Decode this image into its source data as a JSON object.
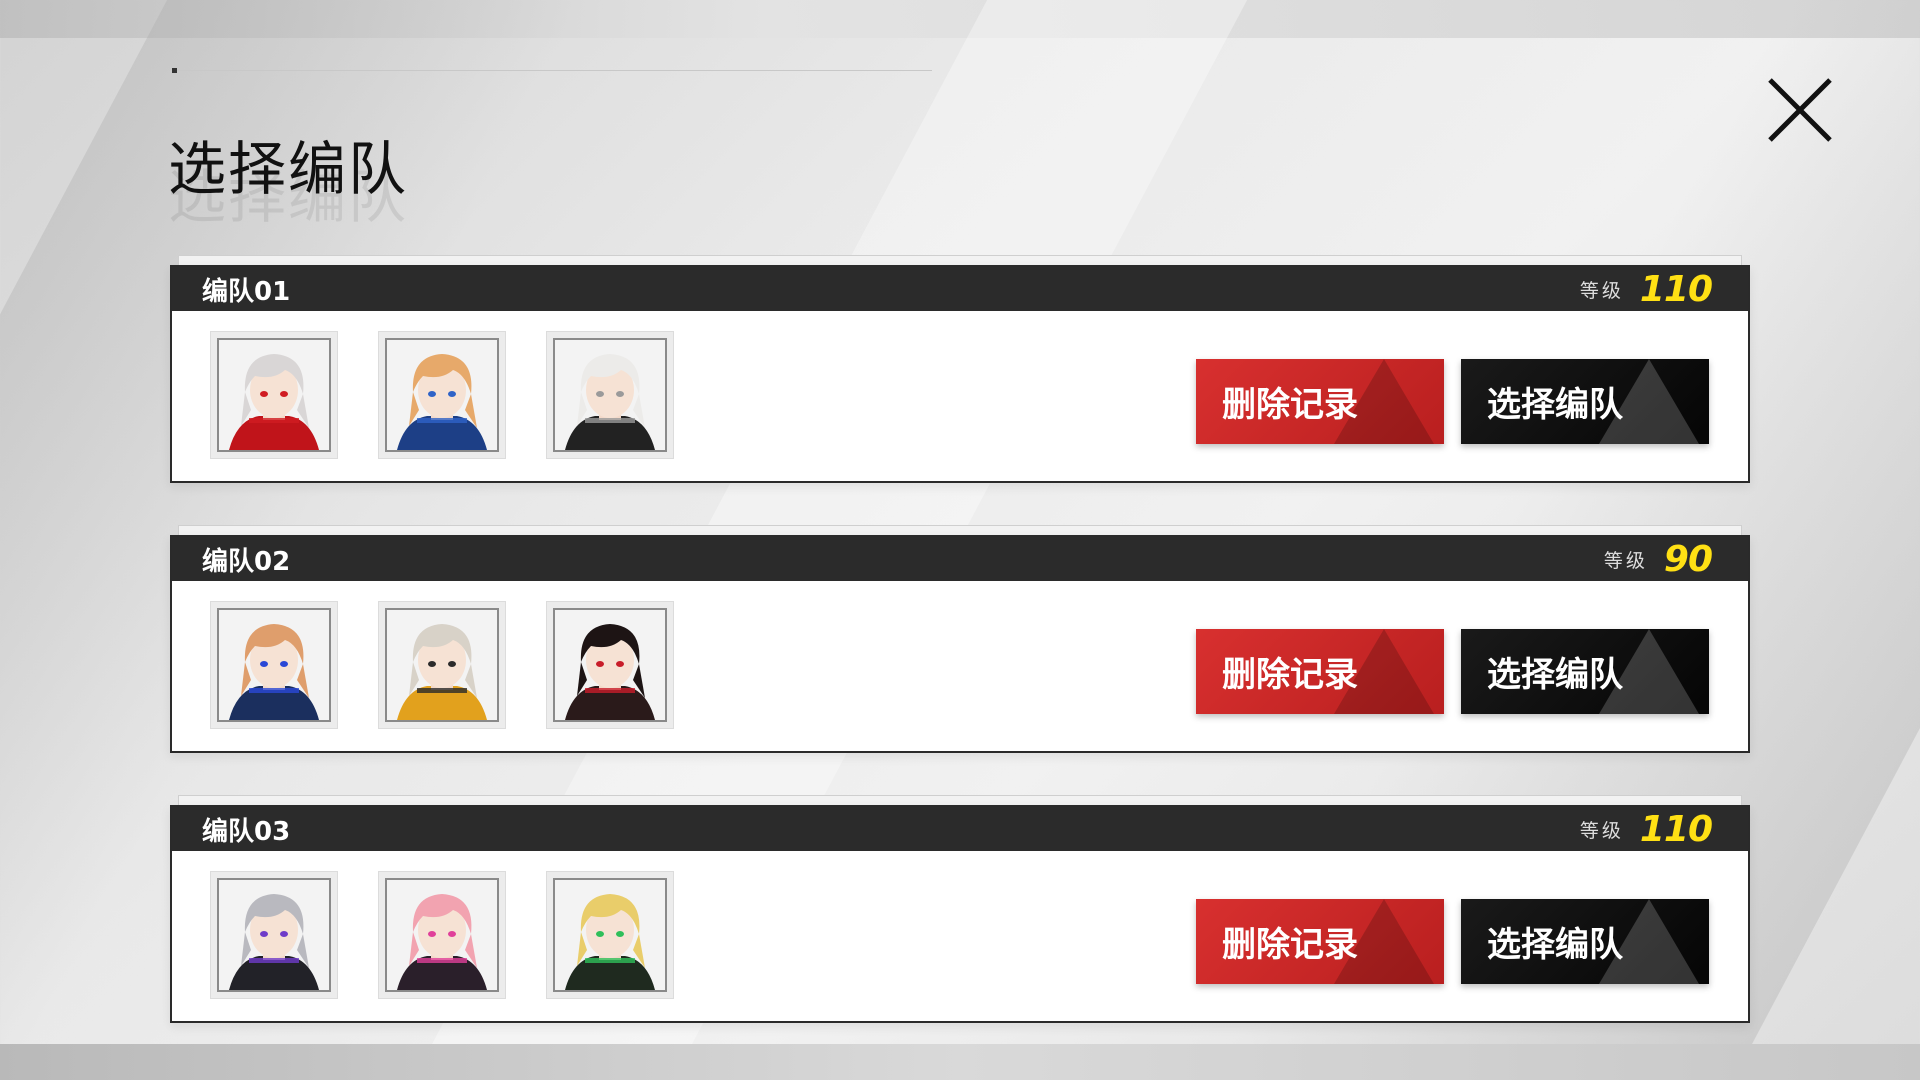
{
  "page": {
    "title": "选择编队"
  },
  "teams": [
    {
      "name": "编队01",
      "level_label": "等级",
      "level": "110",
      "delete_label": "删除记录",
      "select_label": "选择编队",
      "avatars": [
        {
          "icon": "character-silver-hair-red-headphones",
          "hair": "#d9d6d6",
          "outfit": "#c0141a",
          "accent": "#d01c22"
        },
        {
          "icon": "character-orange-hair-blue-collar",
          "hair": "#e7a96a",
          "outfit": "#1d3f86",
          "accent": "#2f63c7"
        },
        {
          "icon": "character-white-hair-black-outfit",
          "hair": "#ecebe9",
          "outfit": "#222222",
          "accent": "#9a9a9a"
        }
      ]
    },
    {
      "name": "编队02",
      "level_label": "等级",
      "level": "90",
      "delete_label": "删除记录",
      "select_label": "选择编队",
      "avatars": [
        {
          "icon": "character-orange-hair-blue-horn",
          "hair": "#df9e6c",
          "outfit": "#1b2f5e",
          "accent": "#2a48d6"
        },
        {
          "icon": "character-silver-hair-yellow-outfit",
          "hair": "#d8d2c8",
          "outfit": "#e2a11d",
          "accent": "#2b2b2b"
        },
        {
          "icon": "character-black-hair-red-eyes",
          "hair": "#1d1414",
          "outfit": "#2a1a1a",
          "accent": "#c81d2a"
        }
      ]
    },
    {
      "name": "编队03",
      "level_label": "等级",
      "level": "110",
      "delete_label": "删除记录",
      "select_label": "选择编队",
      "avatars": [
        {
          "icon": "character-grey-hair-purple-headset",
          "hair": "#b9b9bf",
          "outfit": "#222228",
          "accent": "#6f3cc9"
        },
        {
          "icon": "character-pink-hair-black-cap",
          "hair": "#f2a3b0",
          "outfit": "#2a1f2a",
          "accent": "#e0409a"
        },
        {
          "icon": "character-blonde-hair-green-hood",
          "hair": "#e9cd6a",
          "outfit": "#1f2a1f",
          "accent": "#2fbf5a"
        }
      ]
    }
  ],
  "colors": {
    "delete": "#c8282a",
    "select": "#0d0d0d",
    "level": "#ffe014",
    "header": "#2b2b2b"
  }
}
